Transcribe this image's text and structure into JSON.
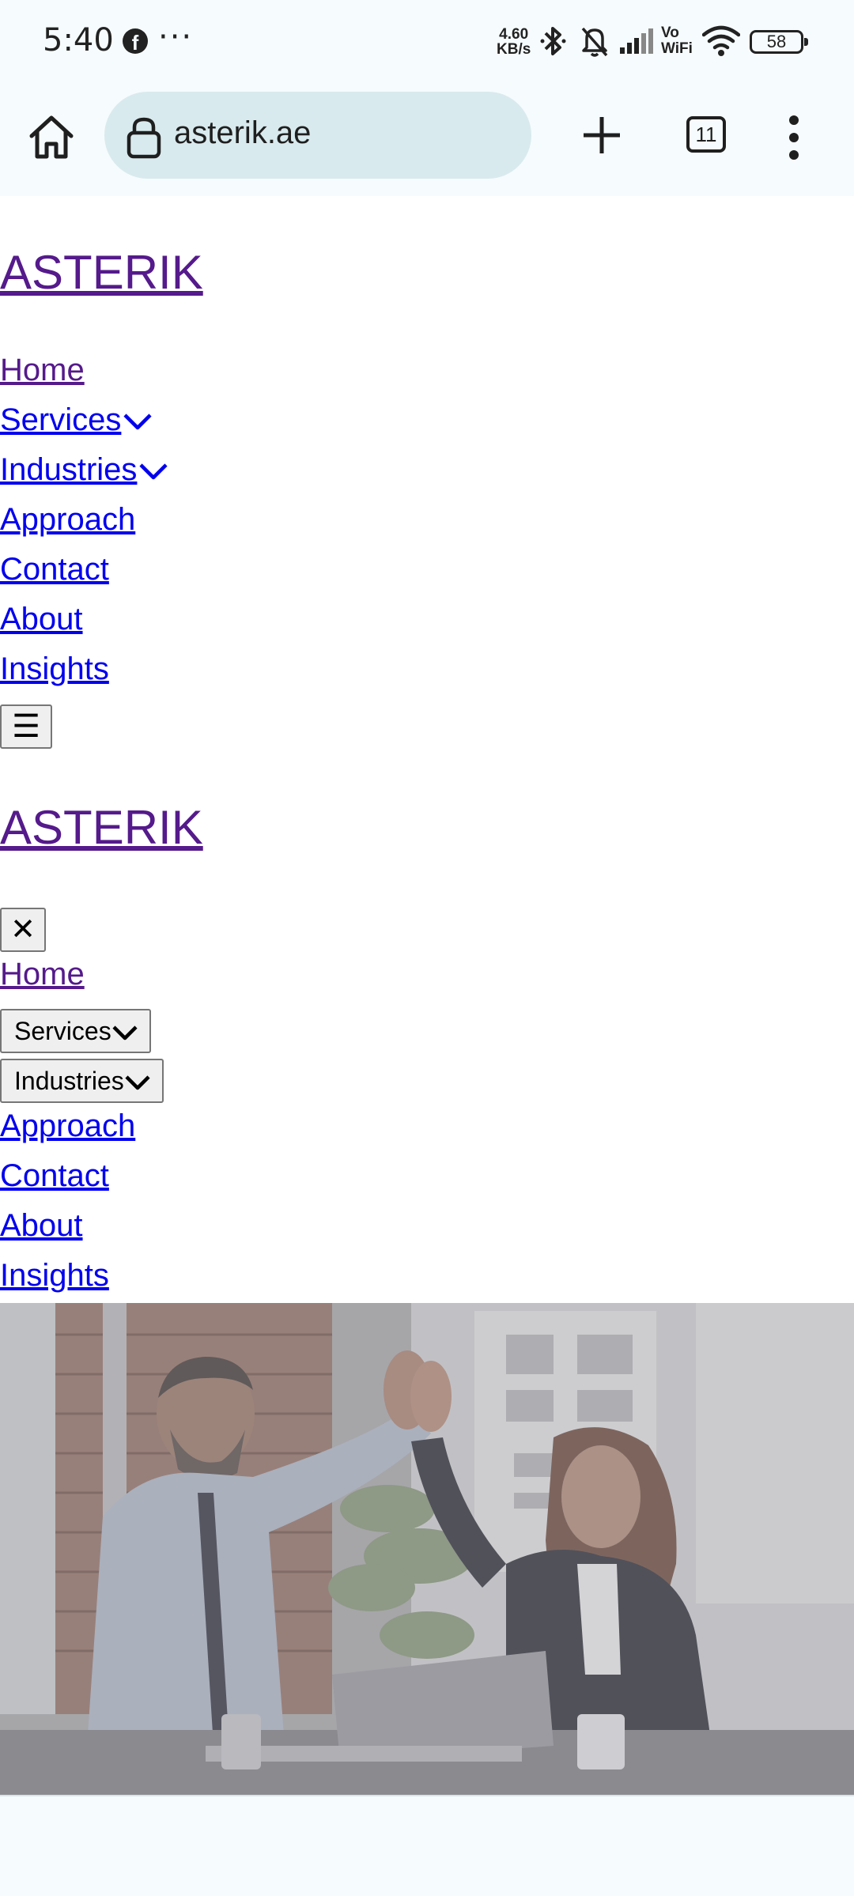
{
  "status_bar": {
    "time": "5:40",
    "network_speed_value": "4.60",
    "network_speed_unit": "KB/s",
    "vowifi_top": "Vo",
    "vowifi_bottom": "WiFi",
    "battery": "58"
  },
  "browser": {
    "url": "asterik.ae",
    "tab_count": "11"
  },
  "site": {
    "brand": "ASTERIK",
    "nav": {
      "home": "Home",
      "services": "Services",
      "industries": "Industries",
      "approach": "Approach",
      "contact": "Contact",
      "about": "About",
      "insights": "Insights"
    },
    "hamburger_symbol": "☰",
    "mobile_brand": "ASTERIK",
    "close_symbol": "✕",
    "mobile_nav": {
      "home": "Home",
      "services": "Services",
      "industries": "Industries",
      "approach": "Approach",
      "contact": "Contact",
      "about": "About",
      "insights": "Insights"
    }
  },
  "colors": {
    "link": "#0000ee",
    "visited_link": "#551a8b",
    "url_bar": "#d9eaee",
    "chrome_background": "#f6fbfd"
  }
}
